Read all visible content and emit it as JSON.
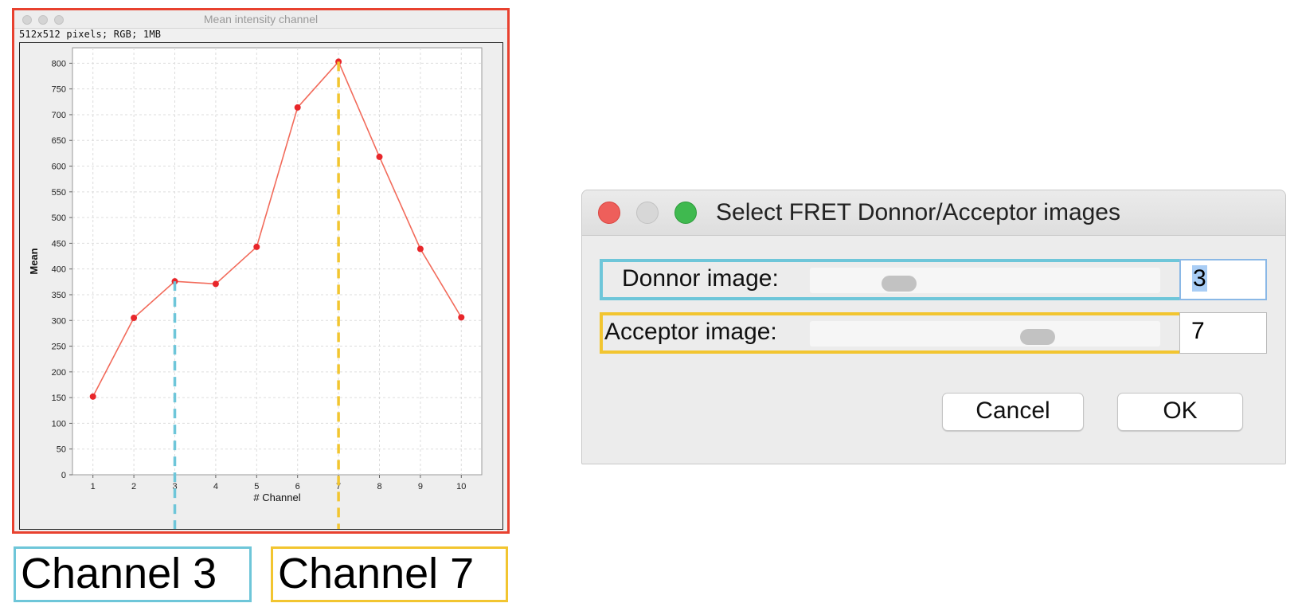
{
  "plot_window": {
    "title": "Mean intensity channel",
    "info": "512x512 pixels; RGB; 1MB"
  },
  "chart_data": {
    "type": "line",
    "x": [
      1,
      2,
      3,
      4,
      5,
      6,
      7,
      8,
      9,
      10
    ],
    "values": [
      152,
      305,
      376,
      371,
      443,
      714,
      803,
      618,
      439,
      306
    ],
    "xlabel": "# Channel",
    "ylabel": "Mean",
    "xlim": [
      0.5,
      10.5
    ],
    "ylim": [
      0,
      830
    ],
    "yticks": [
      0,
      50,
      100,
      150,
      200,
      250,
      300,
      350,
      400,
      450,
      500,
      550,
      600,
      650,
      700,
      750,
      800
    ],
    "xticks": [
      1,
      2,
      3,
      4,
      5,
      6,
      7,
      8,
      9,
      10
    ],
    "grid": true,
    "line_color": "#f26b5b",
    "marker_color": "#e8262a",
    "highlights": [
      {
        "x": 3,
        "color": "#6ec6d9"
      },
      {
        "x": 7,
        "color": "#f2c530"
      }
    ]
  },
  "labels": {
    "channel_3": "Channel 3",
    "channel_7": "Channel 7"
  },
  "dialog": {
    "title": "Select FRET Donnor/Acceptor images",
    "donor_label": "Donnor image:",
    "donor_value": "3",
    "acceptor_label": "Acceptor image:",
    "acceptor_value": "7",
    "cancel_label": "Cancel",
    "ok_label": "OK"
  },
  "colors": {
    "plot_border": "#e8412f",
    "donor_highlight": "#6ec6d9",
    "acceptor_highlight": "#f2c530"
  }
}
